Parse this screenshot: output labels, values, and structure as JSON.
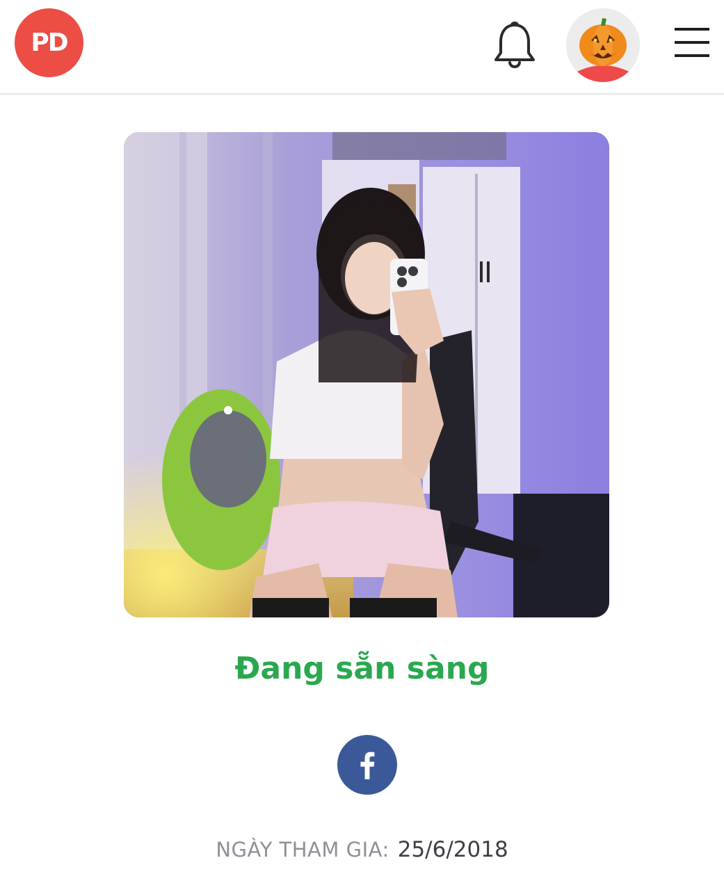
{
  "header": {
    "logo_text": "PD",
    "logo_color": "#ec4d45",
    "notification_icon": "bell-icon",
    "avatar_icon": "jack-o-lantern-avatar",
    "menu_icon": "hamburger-menu-icon"
  },
  "profile": {
    "photo_description_icon": "profile-photo",
    "status_text": "Đang sẵn sàng",
    "status_color": "#2aa84f",
    "social_icon": "facebook-icon",
    "social_color": "#3b5998",
    "join_label": "NGÀY THAM GIA:",
    "join_date": "25/6/2018"
  }
}
